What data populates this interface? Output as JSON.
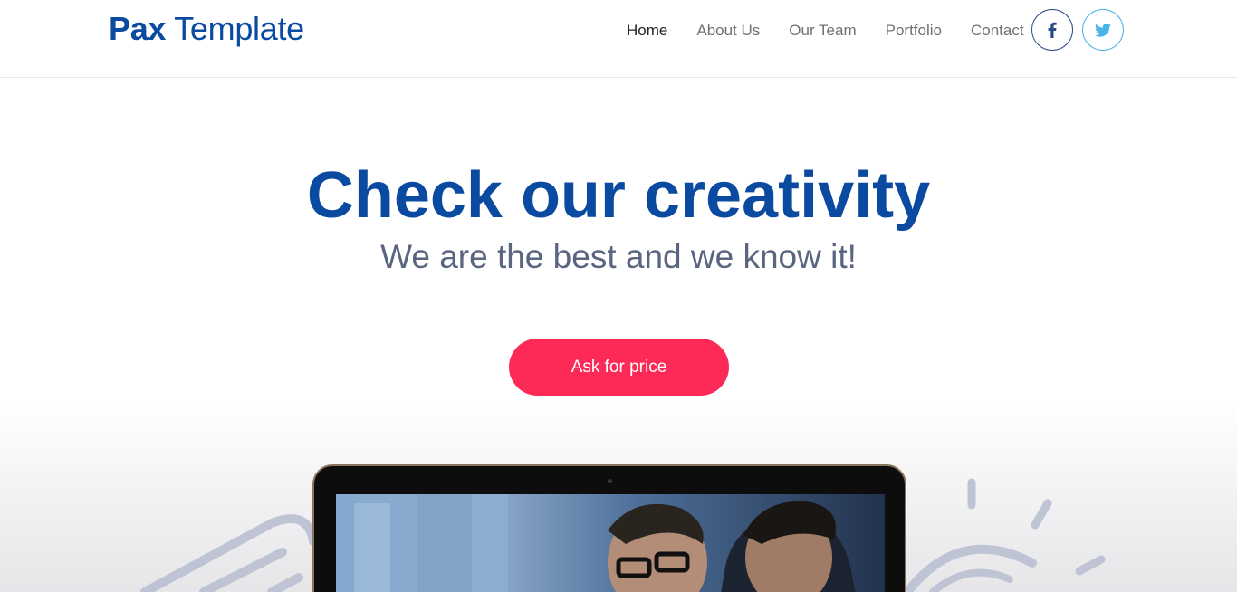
{
  "brand": {
    "name_strong": "Pax",
    "name_light": "Template"
  },
  "nav": {
    "items": [
      {
        "label": "Home",
        "active": true
      },
      {
        "label": "About Us",
        "active": false
      },
      {
        "label": "Our Team",
        "active": false
      },
      {
        "label": "Portfolio",
        "active": false
      },
      {
        "label": "Contact",
        "active": false
      }
    ],
    "social": [
      "facebook-icon",
      "twitter-icon"
    ]
  },
  "hero": {
    "title": "Check our creativity",
    "subtitle": "We are the best and we know it!",
    "cta_label": "Ask for price"
  },
  "colors": {
    "brand": "#0a4aa0",
    "cta": "#fd2a57",
    "subtitle": "#5a6580",
    "facebook": "#2b4a8a",
    "twitter": "#4ab3e8"
  }
}
